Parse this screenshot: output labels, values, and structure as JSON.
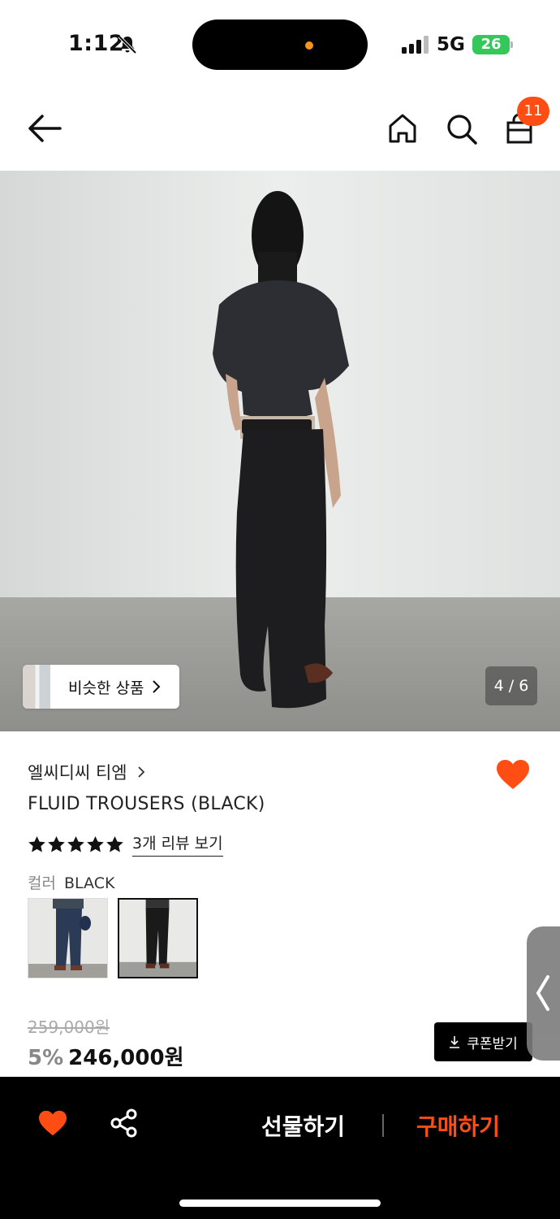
{
  "status_bar": {
    "time": "1:12",
    "network": "5G",
    "battery": "26"
  },
  "header": {
    "cart_count": "11",
    "icons": [
      "back-arrow-icon",
      "home-icon",
      "search-icon",
      "shopping-bag-icon"
    ]
  },
  "gallery": {
    "similar_label": "비슷한 상품",
    "counter": "4 / 6"
  },
  "product": {
    "brand": "엘씨디씨 티엠",
    "title": "FLUID TROUSERS (BLACK)",
    "rating_stars": 5,
    "review_link": "3개 리뷰 보기",
    "color_label": "컬러",
    "color_value": "BLACK",
    "original_price": "259,000원",
    "discount": "5%",
    "price": "246,000원",
    "coupon_label": "쿠폰받기"
  },
  "bottom_bar": {
    "gift_label": "선물하기",
    "buy_label": "구매하기"
  },
  "colors": {
    "accent": "#ff4d14",
    "bottom_bar_bg": "#000000",
    "wishlist_heart": "#ff4d14"
  }
}
